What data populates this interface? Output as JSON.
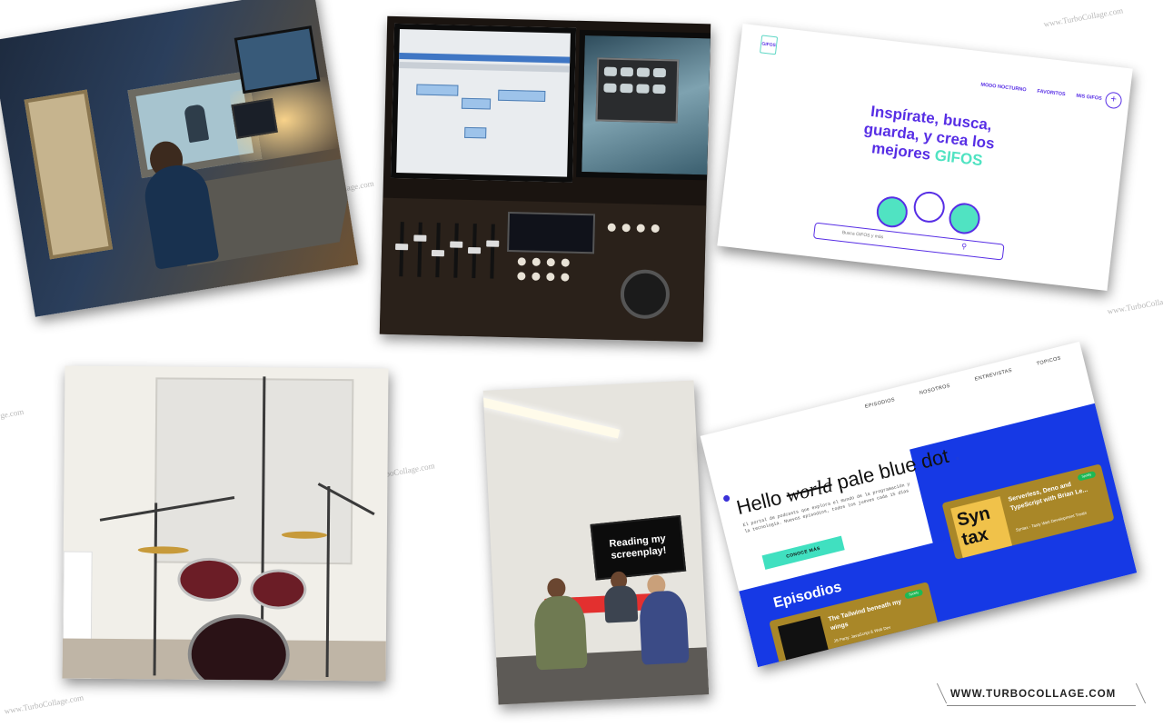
{
  "watermarks": [
    "www.TurboCollage.com",
    "www.TurboCollage.com",
    "ge.com",
    "boCollage.com",
    "ollage.com",
    "www.TurboCollage.com",
    "www.TurboColl"
  ],
  "photos": {
    "control_room": {},
    "daw_controller": {},
    "gifos_site": {
      "logo": "GIFOS",
      "nav": [
        "MODO NOCTURNO",
        "FAVORITOS",
        "MIS GIFOS"
      ],
      "add_symbol": "+",
      "hero_line1": "Inspírate, busca,",
      "hero_line2": "guarda, y crea los",
      "hero_line3": "mejores",
      "hero_accent": "GIFOS",
      "search_placeholder": "Busca GIFOS y más",
      "search_icon": "search-icon",
      "colors": {
        "primary": "#572ee5",
        "accent": "#50e3c2"
      }
    },
    "drum_room": {},
    "reading_room": {
      "tv_text": "Reading my screenplay!"
    },
    "podcast_site": {
      "nav": [
        "EPISODIOS",
        "NOSOTROS",
        "ENTREVISTAS",
        "TOPICOS"
      ],
      "title_hello": "Hello",
      "title_struck": "world",
      "title_rest": "pale blue dot",
      "title_dot": ".",
      "description": "El portal de podcasts que explora el mundo de la programación y la tecnología. Nuevos episodios, todos los jueves cada 15 días",
      "cta": "CONOCE MÁS",
      "section": "Episodios",
      "episodes": [
        {
          "art_text": "JS PARTY",
          "title": "The Tailwind beneath my wings",
          "subtitle": "JS Party: JavaScript & Web Dev",
          "badge": "Spotify"
        },
        {
          "art_text": "Syn tax",
          "title": "Serverless, Deno and TypeScript with Brian Le...",
          "subtitle": "Syntax - Tasty Web Development Treats",
          "badge": "Spotify"
        }
      ],
      "colors": {
        "blue": "#1639e5",
        "teal": "#40e0c0",
        "card": "#a98728"
      }
    }
  },
  "brand": "WWW.TURBOCOLLAGE.COM"
}
